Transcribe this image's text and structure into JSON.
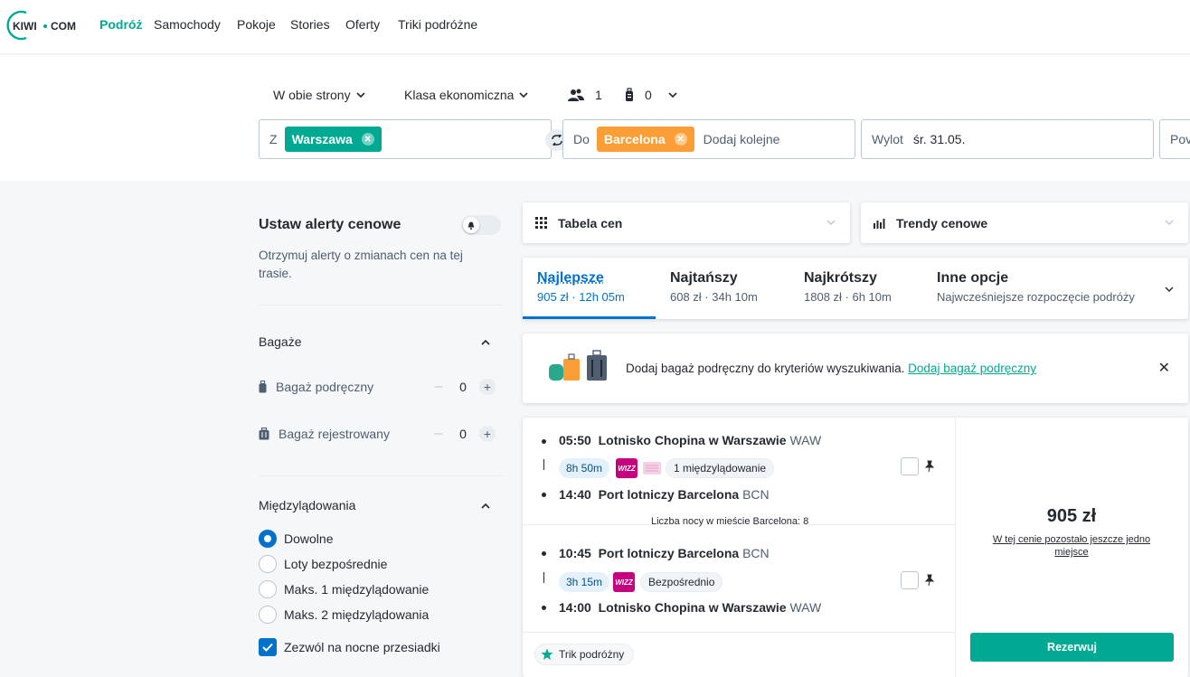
{
  "brand": {
    "logo_text": "KIWI·COM",
    "accent": "#00a991",
    "blue": "#0172cb"
  },
  "nav": {
    "items": [
      "Podróż",
      "Samochody",
      "Pokoje",
      "Stories",
      "Oferty",
      "Triki podróżne"
    ],
    "active": "Podróż"
  },
  "search": {
    "trip_type": "W obie strony",
    "cabin": "Klasa ekonomiczna",
    "passengers": "1",
    "bags": "0",
    "from_label": "Z",
    "from_chip": "Warszawa",
    "from_chip_color": "#00a991",
    "to_label": "Do",
    "to_chip": "Barcelona",
    "to_chip_color": "#fc9e36",
    "to_placeholder": "Dodaj kolejne",
    "depart_label": "Wylot",
    "depart_value": "śr. 31.05.",
    "return_label_partial": "Pov"
  },
  "filters": {
    "alert_title": "Ustaw alerty cenowe",
    "alert_desc": "Otrzymuj alerty o zmianach cen na tej trasie.",
    "bags_title": "Bagaże",
    "bags": [
      {
        "label": "Bagaż podręczny",
        "value": "0",
        "minus": "–",
        "plus": "+"
      },
      {
        "label": "Bagaż rejestrowany",
        "value": "0",
        "minus": "–",
        "plus": "+"
      }
    ],
    "stops_title": "Międzylądowania",
    "stops_options": [
      "Dowolne",
      "Loty bezpośrednie",
      "Maks. 1 międzylądowanie",
      "Maks. 2 międzylądowania"
    ],
    "stops_selected": "Dowolne",
    "overnight": "Zezwól na nocne przesiadki"
  },
  "tools": {
    "price_table": "Tabela cen",
    "price_trends": "Trendy cenowe"
  },
  "sort_tabs": [
    {
      "title": "Najlepsze",
      "sub": "905 zł · 12h 05m",
      "active": true
    },
    {
      "title": "Najtańszy",
      "sub": "608 zł · 34h 10m",
      "active": false
    },
    {
      "title": "Najkrótszy",
      "sub": "1808 zł · 6h 10m",
      "active": false
    },
    {
      "title": "Inne opcje",
      "sub": "Najwcześniejsze rozpoczęcie podróży",
      "active": false
    }
  ],
  "banner": {
    "text": "Dodaj bagaż podręczny do kryteriów wyszukiwania.",
    "link": "Dodaj bagaż podręczny",
    "close": "✕"
  },
  "result": {
    "outbound": {
      "dep_time": "05:50",
      "dep_airport": "Lotnisko Chopina w Warszawie",
      "dep_code": "WAW",
      "duration": "8h 50m",
      "airline": "WIZZ",
      "stops": "1 międzylądowanie",
      "arr_time": "14:40",
      "arr_airport": "Port lotniczy Barcelona",
      "arr_code": "BCN"
    },
    "nights": "Liczba nocy w mieście Barcelona: 8",
    "inbound": {
      "dep_time": "10:45",
      "dep_airport": "Port lotniczy Barcelona",
      "dep_code": "BCN",
      "duration": "3h 15m",
      "airline": "WIZZ",
      "stops": "Bezpośrednio",
      "arr_time": "14:00",
      "arr_airport": "Lotnisko Chopina w Warszawie",
      "arr_code": "WAW"
    },
    "price": "905 zł",
    "price_note_pre": "W tej cenie ",
    "price_note_bold": "pozostało jeszcze jedno miejsce",
    "book": "Rezerwuj",
    "trick": "Trik podróżny"
  }
}
